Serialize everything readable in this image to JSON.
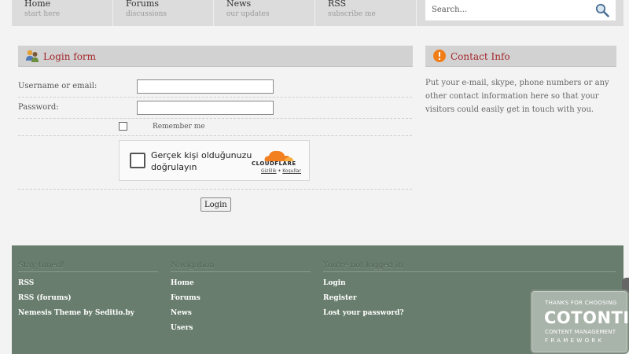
{
  "nav": {
    "items": [
      {
        "title": "Home",
        "subtitle": "start here"
      },
      {
        "title": "Forums",
        "subtitle": "discussions"
      },
      {
        "title": "News",
        "subtitle": "our updates"
      },
      {
        "title": "RSS",
        "subtitle": "subscribe me"
      }
    ],
    "search_placeholder": "Search..."
  },
  "login": {
    "title": "Login form",
    "username_label": "Username or email:",
    "password_label": "Password:",
    "remember_label": "Remember me",
    "button_label": "Login",
    "captcha": {
      "text": "Gerçek kişi olduğunuzu doğrulayın",
      "brand": "CLOUDFLARE",
      "privacy": "Gizlilik",
      "separator": "•",
      "terms": "Koşullar"
    }
  },
  "contact": {
    "title": "Contact Info",
    "text": "Put your e-mail, skype, phone numbers or any other contact information here so that your visitors could easily get in touch with you."
  },
  "footer": {
    "columns": [
      {
        "heading": "Stay tuned!",
        "links": [
          "RSS",
          "RSS (forums)",
          "Nemesis Theme by Seditio.by"
        ]
      },
      {
        "heading": "Navigation",
        "links": [
          "Home",
          "Forums",
          "News",
          "Users"
        ]
      },
      {
        "heading": "You're not logged in",
        "links": [
          "Login",
          "Register",
          "Lost your password?"
        ]
      }
    ],
    "badge": {
      "line1": "THANKS FOR CHOOSING",
      "line2": "COTONTI",
      "line3": "CONTENT MANAGEMENT",
      "line4": "FRAMEWORK"
    }
  },
  "colors": {
    "accent_red": "#a4262c",
    "footer_green": "#687d6d",
    "cloudflare_orange": "#f38020"
  }
}
